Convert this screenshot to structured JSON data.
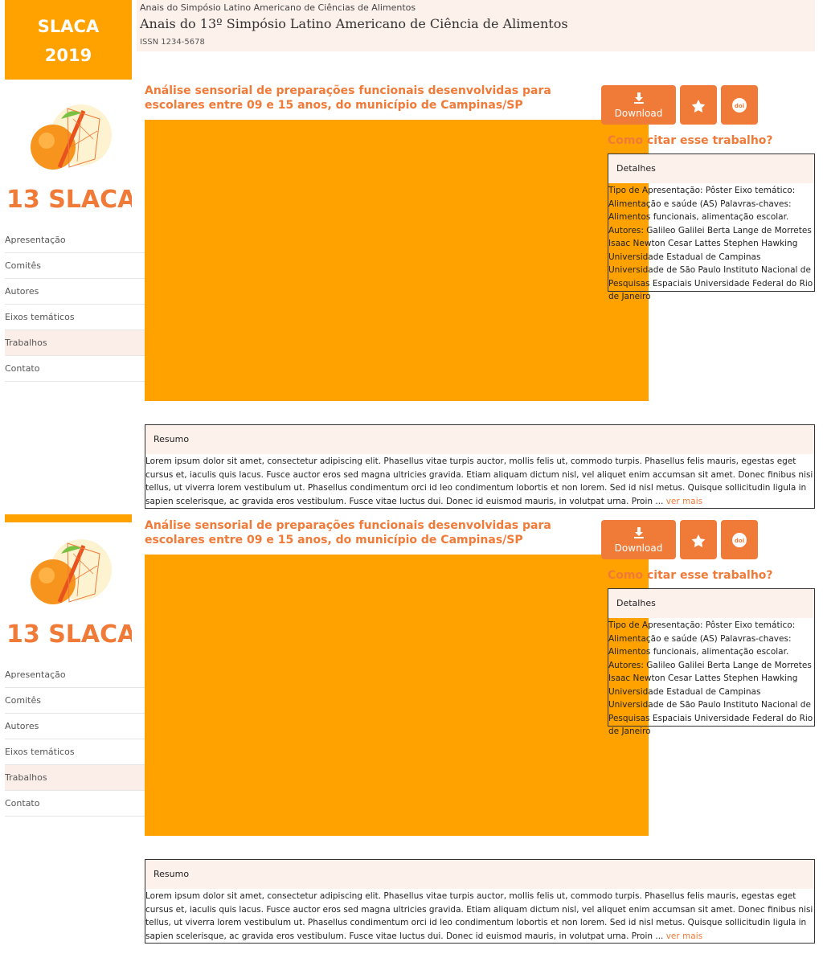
{
  "header": {
    "brand_line1": "SLACA",
    "brand_line2": "2019",
    "subtitle": "Anais do Simpósio Latino Americano de Ciências de Alimentos",
    "title": "Anais do 13º Simpósio Latino Americano de Ciência de Alimentos",
    "issn": "ISSN 1234-5678"
  },
  "logo": {
    "text": "13 SLACA"
  },
  "nav": [
    {
      "label": "Apresentação",
      "active": false
    },
    {
      "label": "Comitês",
      "active": false
    },
    {
      "label": "Autores",
      "active": false
    },
    {
      "label": "Eixos temáticos",
      "active": false
    },
    {
      "label": "Trabalhos",
      "active": true
    },
    {
      "label": "Contato",
      "active": false
    }
  ],
  "article": {
    "title": "Análise sensorial de preparações funcionais desenvolvidas para escolares entre 09 e 15 anos, do município de Campinas/SP",
    "download_label": "Download",
    "cite_label": "Como citar esse trabalho?",
    "details_label": "Detalhes",
    "details_text": "Tipo de Apresentação: Pôster Eixo temático: Alimentação e saúde (AS) Palavras-chaves: Alimentos funcionais, alimentação escolar. Autores: Galileo Galilei Berta Lange de Morretes Isaac Newton Cesar Lattes Stephen Hawking Universidade Estadual de Campinas Universidade de São Paulo Instituto Nacional de Pesquisas Espaciais Universidade Federal do Rio de Janeiro",
    "resumo_label": "Resumo",
    "resumo_text": "Lorem ipsum dolor sit amet, consectetur adipiscing elit. Phasellus vitae turpis auctor, mollis felis ut, commodo turpis. Phasellus felis mauris, egestas eget cursus et, iaculis quis lacus. Fusce auctor eros sed magna ultricies gravida. Etiam aliquam dictum nisl, vel aliquet enim accumsan sit amet. Donec finibus nisi tellus, ut viverra lorem vestibulum ut. Phasellus condimentum orci id leo condimentum lobortis et non lorem. Sed id nisl metus. Quisque sollicitudin ligula in sapien scelerisque, ac gravida eros vestibulum. Fusce vitae luctus dui. Donec id euismod mauris, in volutpat urna. Proin ...",
    "ver_mais": "ver mais"
  },
  "colors": {
    "brand": "#ffa200",
    "accent": "#f07a38",
    "tint": "#fdf1ec"
  },
  "icons": {
    "download": "download-icon",
    "star": "star-icon",
    "doi": "doi-icon"
  }
}
